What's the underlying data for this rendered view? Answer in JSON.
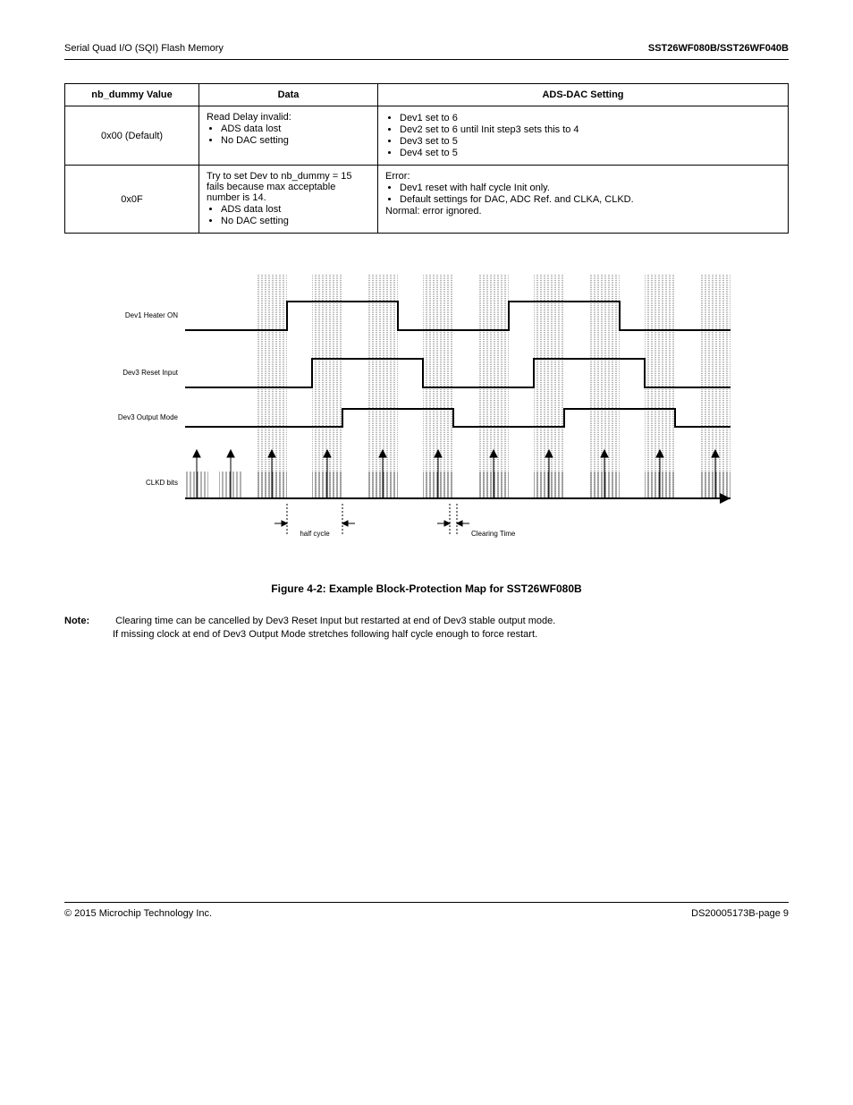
{
  "header": {
    "left": "Serial Quad I/O (SQI) Flash Memory",
    "model": "SST26WF080B/SST26WF040B"
  },
  "table": {
    "headers": [
      "nb_dummy Value",
      "Data",
      "ADS-DAC Setting"
    ],
    "rows": [
      {
        "col0": "0x00 (Default)",
        "col1_lead": "Read Delay invalid:",
        "col1_items": [
          "ADS data lost",
          "No DAC setting"
        ],
        "col2_items": [
          "Dev1 set to 6",
          "Dev2 set to 6 until Init step3 sets this to 4",
          "Dev3 set to 5",
          "Dev4 set to 5"
        ]
      },
      {
        "col0": "0x0F",
        "col1_lead": "Try to set Dev to nb_dummy = 15 fails because max acceptable number is 14.",
        "col1_items": [
          "ADS data lost",
          "No DAC setting"
        ],
        "col2_lead": "Error:",
        "col2_items": [
          "Dev1 reset with half cycle Init only.",
          "Default settings for DAC, ADC Ref. and CLKA, CLKD."
        ],
        "col2_tail": "Normal: error ignored."
      }
    ]
  },
  "figure": {
    "sig1": "Dev1 Heater ON",
    "sig2": "Dev3 Reset Input",
    "sig3": "Dev3 Output Mode",
    "bits_label": "CLKD bits",
    "hcycle": "half cycle",
    "clearing": "Clearing Time",
    "caption": "Figure 4-2: Example Block-Protection Map for SST26WF080B"
  },
  "note": {
    "label": "Note:",
    "line1": "Clearing time can be cancelled by Dev3 Reset Input but restarted at end of Dev3 stable output mode.",
    "line2": "If missing clock at end of Dev3 Output Mode stretches following half cycle enough to force restart."
  },
  "footer": {
    "left": "© 2015 Microchip Technology Inc.",
    "right": "DS20005173B-page 9"
  }
}
